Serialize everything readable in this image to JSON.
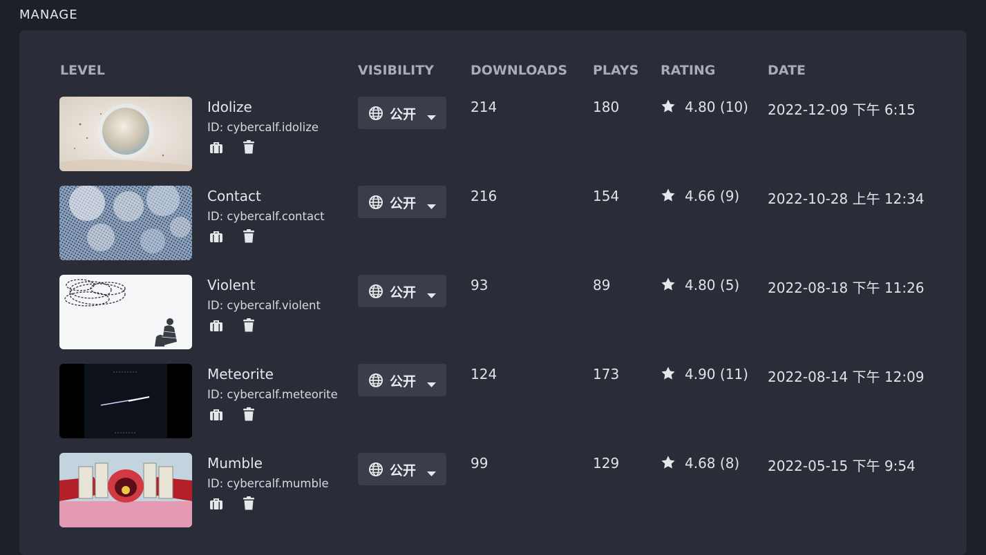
{
  "section": {
    "title": "MANAGE"
  },
  "table": {
    "headers": {
      "level": "LEVEL",
      "visibility": "VISIBILITY",
      "downloads": "DOWNLOADS",
      "plays": "PLAYS",
      "rating": "RATING",
      "date": "DATE"
    },
    "rows": [
      {
        "title": "Idolize",
        "id": "ID: cybercalf.idolize",
        "visibility": "公开",
        "downloads": "214",
        "plays": "180",
        "rating": "4.80 (10)",
        "date": "2022-12-09 下午 6:15"
      },
      {
        "title": "Contact",
        "id": "ID: cybercalf.contact",
        "visibility": "公开",
        "downloads": "216",
        "plays": "154",
        "rating": "4.66 (9)",
        "date": "2022-10-28 上午 12:34"
      },
      {
        "title": "Violent",
        "id": "ID: cybercalf.violent",
        "visibility": "公开",
        "downloads": "93",
        "plays": "89",
        "rating": "4.80 (5)",
        "date": "2022-08-18 下午 11:26"
      },
      {
        "title": "Meteorite",
        "id": "ID: cybercalf.meteorite",
        "visibility": "公开",
        "downloads": "124",
        "plays": "173",
        "rating": "4.90 (11)",
        "date": "2022-08-14 下午 12:09"
      },
      {
        "title": "Mumble",
        "id": "ID: cybercalf.mumble",
        "visibility": "公开",
        "downloads": "99",
        "plays": "129",
        "rating": "4.68 (8)",
        "date": "2022-05-15 下午 9:54"
      }
    ]
  },
  "icons": {
    "visibility": "globe-icon",
    "dropdown": "caret-down-icon",
    "actions": [
      "briefcase-icon",
      "trash-icon"
    ],
    "rating": "star-icon"
  },
  "colors": {
    "background": "#1e2029",
    "panel": "#2a2d38",
    "button": "#3a3e4b",
    "header_text": "#a9acb6"
  }
}
